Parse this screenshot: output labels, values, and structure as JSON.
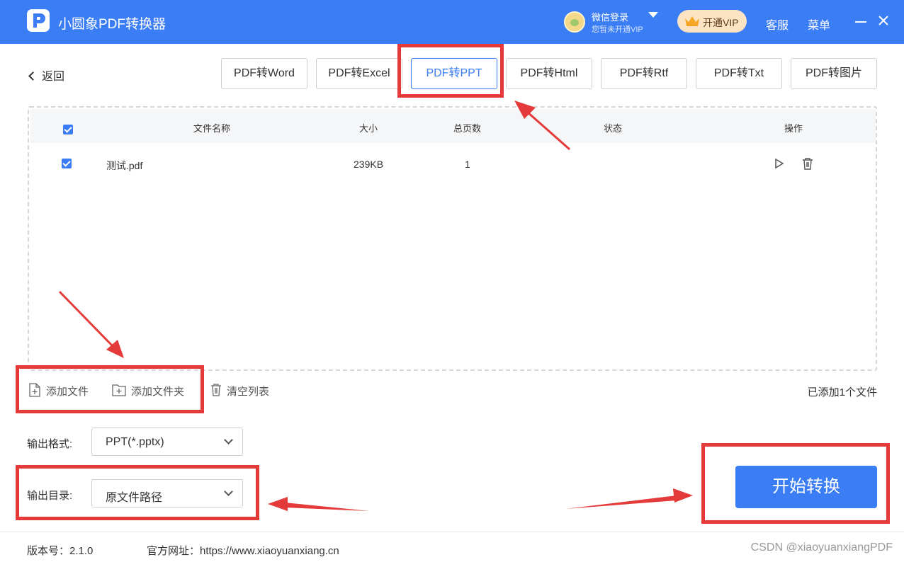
{
  "app": {
    "title": "小圆象PDF转换器",
    "logo_letter": "P"
  },
  "account": {
    "login_label": "微信登录",
    "vip_status": "您暂未开通VIP"
  },
  "header": {
    "vip_button": "开通VIP",
    "service": "客服",
    "menu": "菜单"
  },
  "nav": {
    "back": "返回"
  },
  "tabs": [
    {
      "label": "PDF转Word",
      "active": false
    },
    {
      "label": "PDF转Excel",
      "active": false
    },
    {
      "label": "PDF转PPT",
      "active": true
    },
    {
      "label": "PDF转Html",
      "active": false
    },
    {
      "label": "PDF转Rtf",
      "active": false
    },
    {
      "label": "PDF转Txt",
      "active": false
    },
    {
      "label": "PDF转图片",
      "active": false
    }
  ],
  "table": {
    "columns": {
      "name": "文件名称",
      "size": "大小",
      "pages": "总页数",
      "status": "状态",
      "actions": "操作"
    },
    "rows": [
      {
        "checked": true,
        "name": "测试.pdf",
        "size": "239KB",
        "pages": "1",
        "status": ""
      }
    ]
  },
  "file_actions": {
    "add_file": "添加文件",
    "add_folder": "添加文件夹",
    "clear_list": "清空列表"
  },
  "file_count": "已添加1个文件",
  "output": {
    "format_label": "输出格式:",
    "format_value": "PPT(*.pptx)",
    "dir_label": "输出目录:",
    "dir_value": "原文件路径"
  },
  "start_button": "开始转换",
  "footer": {
    "version": "版本号：2.1.0",
    "website": "官方网址：https://www.xiaoyuanxiang.cn"
  },
  "watermark": "CSDN @xiaoyuanxiangPDF",
  "colors": {
    "primary": "#3a7df5",
    "annotation": "#e53a3a",
    "vip_bg": "#fbe3c4"
  }
}
